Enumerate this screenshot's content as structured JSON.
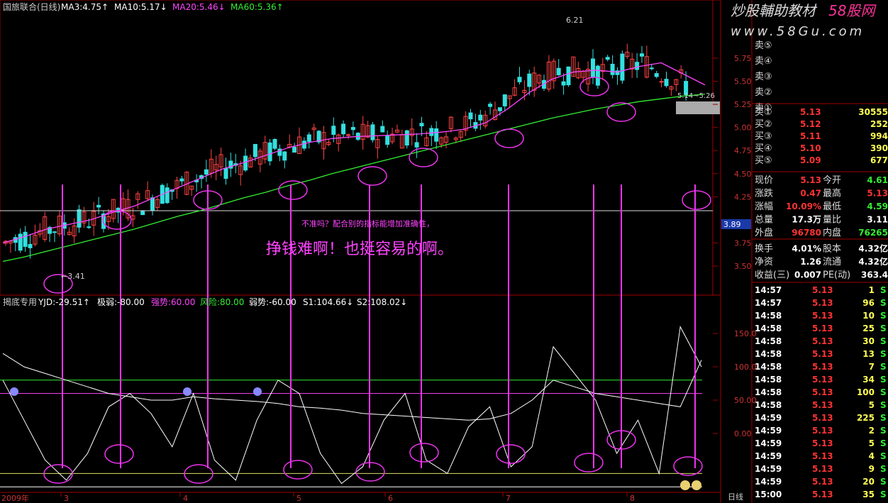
{
  "watermark": {
    "brand": "炒股輔助教材",
    "brand_tag": "58股网",
    "url": "www.58Gu.com"
  },
  "main_header": {
    "title": "国旅联合(日线)",
    "items": [
      {
        "label": "MA3:4.75",
        "arrow": "↑",
        "color": "#ffffff"
      },
      {
        "label": "MA10:5.17",
        "arrow": "↓",
        "color": "#ffffff"
      },
      {
        "label": "MA20:5.46",
        "arrow": "↓",
        "color": "#ff44ff"
      },
      {
        "label": "MA60:5.36",
        "arrow": "↑",
        "color": "#33ee33"
      }
    ]
  },
  "sub_header": {
    "title": "揭底专用",
    "items": [
      {
        "label": "YJD:-29.51",
        "arrow": "↑",
        "color": "#ffffff"
      },
      {
        "label": "极弱:-80.00",
        "arrow": "",
        "color": "#ffffff"
      },
      {
        "label": "强势:60.00",
        "arrow": "",
        "color": "#ff44ff"
      },
      {
        "label": "风险:80.00",
        "arrow": "",
        "color": "#33ee33"
      },
      {
        "label": "弱势:-60.00",
        "arrow": "",
        "color": "#ffffff"
      },
      {
        "label": "S1:104.66",
        "arrow": "↓",
        "color": "#ffffff"
      },
      {
        "label": "S2:108.02",
        "arrow": "↓",
        "color": "#ffffff"
      }
    ]
  },
  "annotations": {
    "small_note": "不准吗？配合别的指标能增加准确性，",
    "big_note": "挣钱难啊！也挺容易的啊。",
    "high_label": "6.21",
    "low_label": "←3.41",
    "price_band_label": "5.14~5.26",
    "current_line_value": "3.89"
  },
  "x_axis": {
    "year": "2009年",
    "months": [
      "3",
      "4",
      "5",
      "6",
      "7",
      "8"
    ],
    "period_button": "日线"
  },
  "order_book": {
    "sell": [
      {
        "label": "卖⑤",
        "price": "",
        "vol": ""
      },
      {
        "label": "卖④",
        "price": "",
        "vol": ""
      },
      {
        "label": "卖③",
        "price": "",
        "vol": ""
      },
      {
        "label": "卖②",
        "price": "",
        "vol": ""
      },
      {
        "label": "卖①",
        "price": "",
        "vol": ""
      }
    ],
    "buy": [
      {
        "label": "买①",
        "price": "5.13",
        "vol": "30555"
      },
      {
        "label": "买②",
        "price": "5.12",
        "vol": "252"
      },
      {
        "label": "买③",
        "price": "5.11",
        "vol": "994"
      },
      {
        "label": "买④",
        "price": "5.10",
        "vol": "390"
      },
      {
        "label": "买⑤",
        "price": "5.09",
        "vol": "677"
      }
    ]
  },
  "quote_stats": [
    {
      "l1": "现价",
      "v1": "5.13",
      "c1": "#ff3333",
      "l2": "今开",
      "v2": "4.61",
      "c2": "#33ee33"
    },
    {
      "l1": "涨跌",
      "v1": "0.47",
      "c1": "#ff3333",
      "l2": "最高",
      "v2": "5.13",
      "c2": "#ff3333"
    },
    {
      "l1": "涨幅",
      "v1": "10.09%",
      "c1": "#ff3333",
      "l2": "最低",
      "v2": "4.59",
      "c2": "#33ee33"
    },
    {
      "l1": "总量",
      "v1": "17.3万",
      "c1": "#ffffff",
      "l2": "量比",
      "v2": "3.11",
      "c2": "#ffffff"
    },
    {
      "l1": "外盘",
      "v1": "96780",
      "c1": "#ff3333",
      "l2": "内盘",
      "v2": "76265",
      "c2": "#33ee33"
    },
    {
      "l1": "换手",
      "v1": "4.01%",
      "c1": "#ffffff",
      "l2": "股本",
      "v2": "4.32亿",
      "c2": "#ffffff"
    },
    {
      "l1": "净资",
      "v1": "1.26",
      "c1": "#ffffff",
      "l2": "流通",
      "v2": "4.32亿",
      "c2": "#ffffff"
    },
    {
      "l1": "收益(三)",
      "v1": "0.007",
      "c1": "#ffffff",
      "l2": "PE(动)",
      "v2": "363.4",
      "c2": "#ffffff"
    }
  ],
  "ticks": [
    {
      "time": "14:57",
      "price": "5.13",
      "vol": "1",
      "side": "S"
    },
    {
      "time": "14:57",
      "price": "5.13",
      "vol": "96",
      "side": "S"
    },
    {
      "time": "14:58",
      "price": "5.13",
      "vol": "10",
      "side": "S"
    },
    {
      "time": "14:58",
      "price": "5.13",
      "vol": "25",
      "side": "S"
    },
    {
      "time": "14:58",
      "price": "5.13",
      "vol": "30",
      "side": "S"
    },
    {
      "time": "14:58",
      "price": "5.13",
      "vol": "13",
      "side": "S"
    },
    {
      "time": "14:58",
      "price": "5.13",
      "vol": "7",
      "side": "S"
    },
    {
      "time": "14:58",
      "price": "5.13",
      "vol": "34",
      "side": "S"
    },
    {
      "time": "14:58",
      "price": "5.13",
      "vol": "100",
      "side": "S"
    },
    {
      "time": "14:58",
      "price": "5.13",
      "vol": "5",
      "side": "S"
    },
    {
      "time": "14:59",
      "price": "5.13",
      "vol": "225",
      "side": "S"
    },
    {
      "time": "14:59",
      "price": "5.13",
      "vol": "2",
      "side": "S"
    },
    {
      "time": "14:59",
      "price": "5.13",
      "vol": "5",
      "side": "S"
    },
    {
      "time": "14:59",
      "price": "5.13",
      "vol": "4",
      "side": "S"
    },
    {
      "time": "14:59",
      "price": "5.13",
      "vol": "9",
      "side": "S"
    },
    {
      "time": "14:59",
      "price": "5.13",
      "vol": "20",
      "side": "S"
    },
    {
      "time": "15:00",
      "price": "5.13",
      "vol": "35",
      "side": "S"
    }
  ],
  "chart_data": [
    {
      "type": "line",
      "title": "国旅联合(日线)",
      "y_ticks": [
        "5.75",
        "5.50",
        "5.25",
        "5.00",
        "4.75",
        "4.50",
        "4.25",
        "3.75",
        "3.50"
      ],
      "ylim": [
        3.41,
        6.21
      ],
      "x_ticks": [
        "2009年",
        "3",
        "4",
        "5",
        "6",
        "7",
        "8"
      ],
      "series": [
        {
          "name": "MA60",
          "color": "#33ee33",
          "values": [
            3.55,
            3.6,
            3.66,
            3.72,
            3.78,
            3.84,
            3.9,
            3.97,
            4.04,
            4.1,
            4.17,
            4.24,
            4.3,
            4.37,
            4.43,
            4.5,
            4.56,
            4.62,
            4.68,
            4.74,
            4.8,
            4.86,
            4.92,
            4.98,
            5.04,
            5.1,
            5.15,
            5.2,
            5.24,
            5.28,
            5.31,
            5.34,
            5.36
          ]
        },
        {
          "name": "MA20",
          "color": "#ff44ff",
          "values": [
            3.75,
            3.82,
            3.9,
            3.95,
            4.0,
            4.08,
            4.15,
            4.25,
            4.35,
            4.45,
            4.55,
            4.62,
            4.7,
            4.78,
            4.84,
            4.88,
            4.9,
            4.91,
            4.92,
            4.93,
            4.95,
            4.98,
            5.05,
            5.2,
            5.38,
            5.52,
            5.6,
            5.62,
            5.6,
            5.66,
            5.7,
            5.58,
            5.46
          ]
        }
      ],
      "candles_hint": "daily OHLC bars; low 3.41 in March, high 6.21 in July"
    },
    {
      "type": "line",
      "title": "揭底专用",
      "y_ticks": [
        "150.0",
        "100.0",
        "50.00",
        "0.00"
      ],
      "ylim": [
        -80,
        170
      ],
      "reference_lines": [
        {
          "name": "强势",
          "value": 60
        },
        {
          "name": "风险",
          "value": 80
        },
        {
          "name": "极弱",
          "value": -80
        },
        {
          "name": "弱势",
          "value": -60
        }
      ],
      "series": [
        {
          "name": "YJD",
          "values": [
            80,
            20,
            -40,
            -70,
            -30,
            40,
            60,
            30,
            -20,
            60,
            -40,
            -70,
            20,
            80,
            60,
            -30,
            -75,
            -50,
            20,
            60,
            -40,
            -60,
            10,
            40,
            -50,
            -20,
            130,
            90,
            50,
            -30,
            20,
            -60,
            160,
            100
          ]
        },
        {
          "name": "S1",
          "values": [
            120,
            100,
            90,
            80,
            70,
            60,
            55,
            50,
            50,
            55,
            52,
            50,
            48,
            45,
            40,
            38,
            35,
            30,
            28,
            26,
            24,
            22,
            20,
            22,
            30,
            50,
            80,
            70,
            60,
            55,
            50,
            45,
            40,
            110
          ]
        }
      ]
    }
  ]
}
